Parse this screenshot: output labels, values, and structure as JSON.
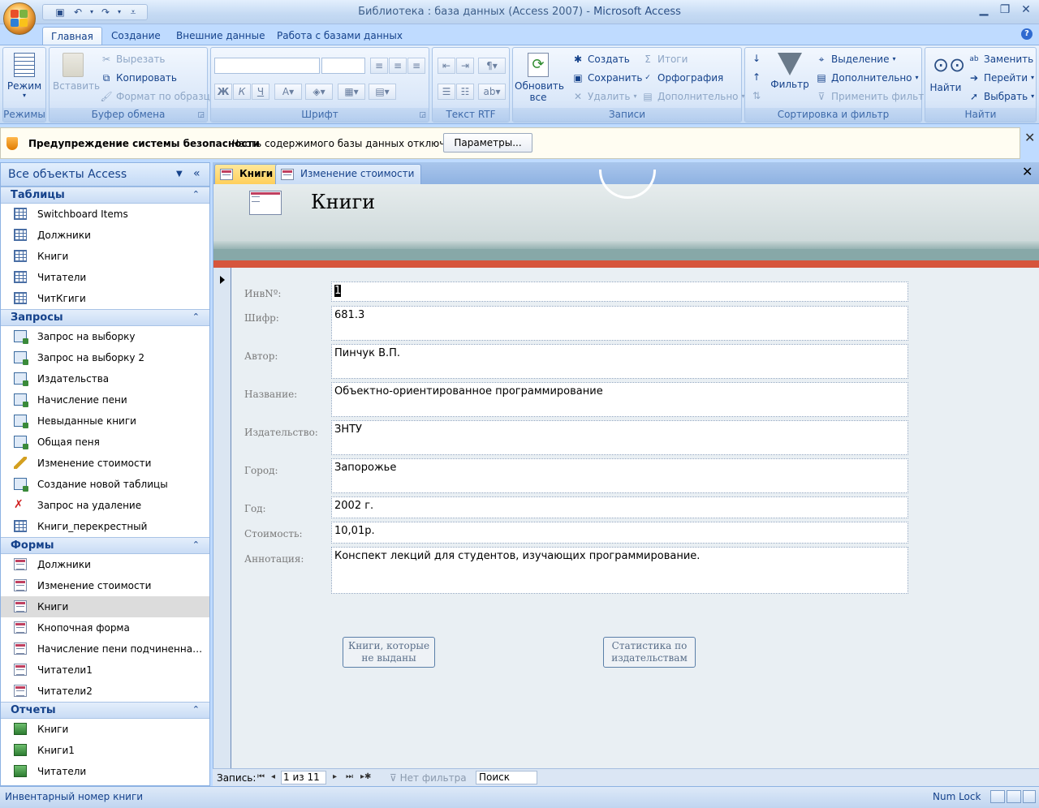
{
  "window": {
    "title": "Библиотека : база данных (Access 2007)",
    "app_name": "Microsoft Access",
    "separator": " - "
  },
  "ribbon_tabs": [
    "Главная",
    "Создание",
    "Внешние данные",
    "Работа с базами данных"
  ],
  "ribbon": {
    "views": {
      "mode": "Режим",
      "group": "Режимы"
    },
    "clipboard": {
      "paste": "Вставить",
      "cut": "Вырезать",
      "copy": "Копировать",
      "format_painter": "Формат по образцу",
      "group": "Буфер обмена"
    },
    "font": {
      "group": "Шрифт",
      "bold": "Ж",
      "italic": "К",
      "underline": "Ч"
    },
    "rtf": {
      "group": "Текст RTF"
    },
    "records": {
      "refresh_line1": "Обновить",
      "refresh_line2": "все",
      "new": "Создать",
      "save": "Сохранить",
      "delete": "Удалить",
      "totals": "Итоги",
      "spelling": "Орфография",
      "more": "Дополнительно",
      "group": "Записи"
    },
    "sort_filter": {
      "filter": "Фильтр",
      "selection": "Выделение",
      "advanced": "Дополнительно",
      "apply": "Применить фильтр",
      "group": "Сортировка и фильтр"
    },
    "find": {
      "find": "Найти",
      "replace": "Заменить",
      "goto": "Перейти",
      "select": "Выбрать",
      "group": "Найти"
    }
  },
  "security_bar": {
    "title": "Предупреждение системы безопасности",
    "message": "Часть содержимого базы данных отключено",
    "options_button": "Параметры..."
  },
  "nav_pane": {
    "title": "Все объекты Access",
    "sections": {
      "tables": {
        "title": "Таблицы",
        "items": [
          "Switchboard Items",
          "Должники",
          "Книги",
          "Читатели",
          "ЧитКгиги"
        ]
      },
      "queries": {
        "title": "Запросы",
        "items": [
          "Запрос на выборку",
          "Запрос на выборку 2",
          "Издательства",
          "Начисление пени",
          "Невыданные книги",
          "Общая пеня",
          "Изменение стоимости",
          "Создание новой таблицы",
          "Запрос на удаление",
          "Книги_перекрестный"
        ]
      },
      "forms": {
        "title": "Формы",
        "items": [
          "Должники",
          "Изменение стоимости",
          "Книги",
          "Кнопочная форма",
          "Начисление пени подчиненная фо...",
          "Читатели1",
          "Читатели2"
        ],
        "selected": "Книги"
      },
      "reports": {
        "title": "Отчеты",
        "items": [
          "Книги",
          "Книги1",
          "Читатели"
        ]
      }
    }
  },
  "doc_tabs": [
    "Книги",
    "Изменение стоимости"
  ],
  "form": {
    "title": "Книги",
    "fields": {
      "inv_label": "ИнвNº:",
      "inv_value": "1",
      "cipher_label": "Шифр:",
      "cipher_value": "681.3",
      "author_label": "Автор:",
      "author_value": "Пинчук В.П.",
      "name_label": "Название:",
      "name_value": "Объектно-ориентированное программирование",
      "publisher_label": "Издательство:",
      "publisher_value": "ЗНТУ",
      "city_label": "Город:",
      "city_value": "Запорожье",
      "year_label": "Год:",
      "year_value": "2002 г.",
      "price_label": "Стоимость:",
      "price_value": "10,01р.",
      "annotation_label": "Аннотация:",
      "annotation_value": "Конспект лекций для студентов, изучающих программирование."
    },
    "buttons": {
      "not_issued_line1": "Книги, которые",
      "not_issued_line2": "не выданы",
      "stats_line1": "Статистика по",
      "stats_line2": "издательствам"
    }
  },
  "record_nav": {
    "label": "Запись:",
    "position": "1 из 11",
    "filter": "Нет фильтра",
    "search": "Поиск"
  },
  "status_bar": {
    "text": "Инвентарный номер книги",
    "numlock": "Num Lock"
  },
  "colors": {
    "ribbon_blue": "#bfdbff",
    "active_tab": "#ffcf5a",
    "form_band": "#d6553c",
    "header_teal": "#87a8a8"
  }
}
